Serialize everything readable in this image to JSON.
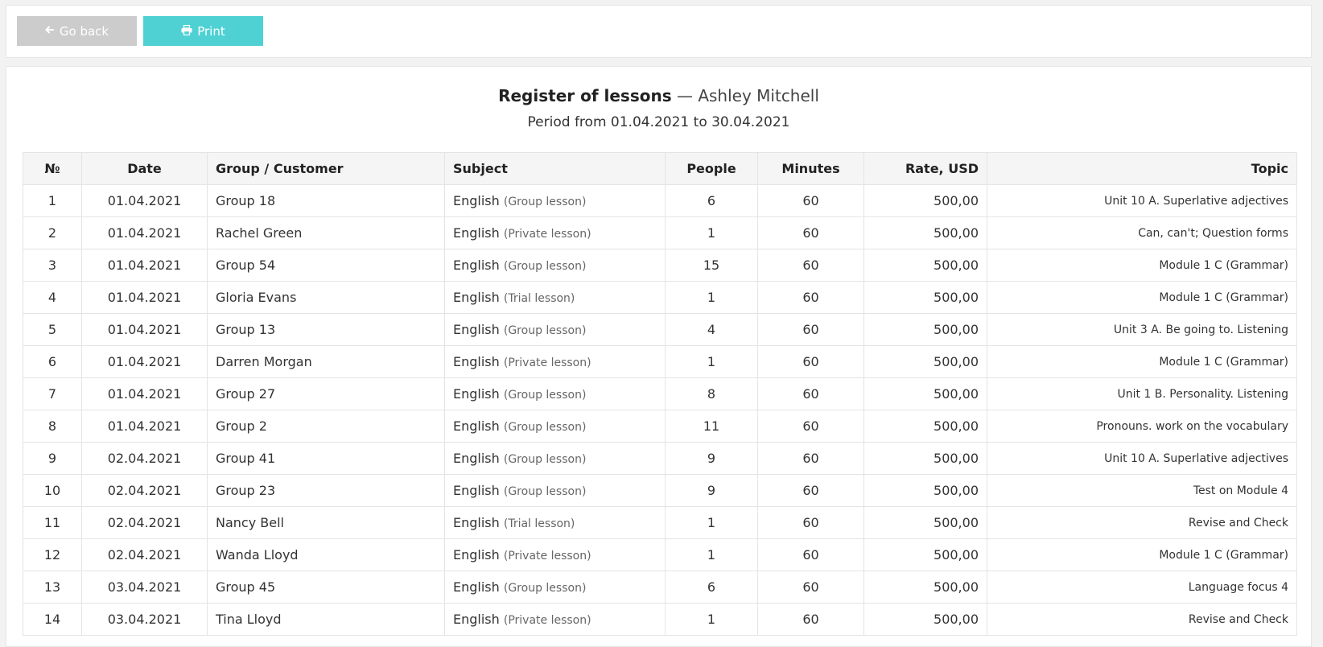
{
  "toolbar": {
    "back_label": "Go back",
    "back_icon": "arrow-left-icon",
    "print_label": "Print",
    "print_icon": "printer-icon"
  },
  "report": {
    "title": "Register of lessons",
    "dash": "—",
    "teacher": "Ashley Mitchell",
    "period": "Period from 01.04.2021 to 30.04.2021"
  },
  "table": {
    "headers": {
      "num": "№",
      "date": "Date",
      "customer": "Group / Customer",
      "subject": "Subject",
      "people": "People",
      "minutes": "Minutes",
      "rate": "Rate, USD",
      "topic": "Topic"
    },
    "rows": [
      {
        "num": "1",
        "date": "01.04.2021",
        "customer": "Group 18",
        "subject": "English",
        "type": "(Group lesson)",
        "people": "6",
        "minutes": "60",
        "rate": "500,00",
        "topic": "Unit 10 A. Superlative adjectives"
      },
      {
        "num": "2",
        "date": "01.04.2021",
        "customer": "Rachel Green",
        "subject": "English",
        "type": "(Private lesson)",
        "people": "1",
        "minutes": "60",
        "rate": "500,00",
        "topic": "Can, can't; Question forms"
      },
      {
        "num": "3",
        "date": "01.04.2021",
        "customer": "Group 54",
        "subject": "English",
        "type": "(Group lesson)",
        "people": "15",
        "minutes": "60",
        "rate": "500,00",
        "topic": "Module 1 C (Grammar)"
      },
      {
        "num": "4",
        "date": "01.04.2021",
        "customer": "Gloria Evans",
        "subject": "English",
        "type": "(Trial lesson)",
        "people": "1",
        "minutes": "60",
        "rate": "500,00",
        "topic": "Module 1 C (Grammar)"
      },
      {
        "num": "5",
        "date": "01.04.2021",
        "customer": "Group 13",
        "subject": "English",
        "type": "(Group lesson)",
        "people": "4",
        "minutes": "60",
        "rate": "500,00",
        "topic": "Unit 3 A. Be going to. Listening"
      },
      {
        "num": "6",
        "date": "01.04.2021",
        "customer": "Darren Morgan",
        "subject": "English",
        "type": "(Private lesson)",
        "people": "1",
        "minutes": "60",
        "rate": "500,00",
        "topic": "Module 1 C (Grammar)"
      },
      {
        "num": "7",
        "date": "01.04.2021",
        "customer": "Group 27",
        "subject": "English",
        "type": "(Group lesson)",
        "people": "8",
        "minutes": "60",
        "rate": "500,00",
        "topic": "Unit 1 B. Personality. Listening"
      },
      {
        "num": "8",
        "date": "01.04.2021",
        "customer": "Group 2",
        "subject": "English",
        "type": "(Group lesson)",
        "people": "11",
        "minutes": "60",
        "rate": "500,00",
        "topic": "Pronouns. work on the vocabulary"
      },
      {
        "num": "9",
        "date": "02.04.2021",
        "customer": "Group 41",
        "subject": "English",
        "type": "(Group lesson)",
        "people": "9",
        "minutes": "60",
        "rate": "500,00",
        "topic": "Unit 10 A. Superlative adjectives"
      },
      {
        "num": "10",
        "date": "02.04.2021",
        "customer": "Group 23",
        "subject": "English",
        "type": "(Group lesson)",
        "people": "9",
        "minutes": "60",
        "rate": "500,00",
        "topic": "Test on Module 4"
      },
      {
        "num": "11",
        "date": "02.04.2021",
        "customer": "Nancy Bell",
        "subject": "English",
        "type": "(Trial lesson)",
        "people": "1",
        "minutes": "60",
        "rate": "500,00",
        "topic": "Revise and Check"
      },
      {
        "num": "12",
        "date": "02.04.2021",
        "customer": "Wanda Lloyd",
        "subject": "English",
        "type": "(Private lesson)",
        "people": "1",
        "minutes": "60",
        "rate": "500,00",
        "topic": "Module 1 C (Grammar)"
      },
      {
        "num": "13",
        "date": "03.04.2021",
        "customer": "Group 45",
        "subject": "English",
        "type": "(Group lesson)",
        "people": "6",
        "minutes": "60",
        "rate": "500,00",
        "topic": "Language focus 4"
      },
      {
        "num": "14",
        "date": "03.04.2021",
        "customer": "Tina Lloyd",
        "subject": "English",
        "type": "(Private lesson)",
        "people": "1",
        "minutes": "60",
        "rate": "500,00",
        "topic": "Revise and Check"
      }
    ]
  },
  "colors": {
    "page_bg": "#f2f2f2",
    "back_button": "#cccccc",
    "print_button": "#4fd1d4",
    "header_bg": "#f5f5f5",
    "border": "#e4e4e4"
  }
}
